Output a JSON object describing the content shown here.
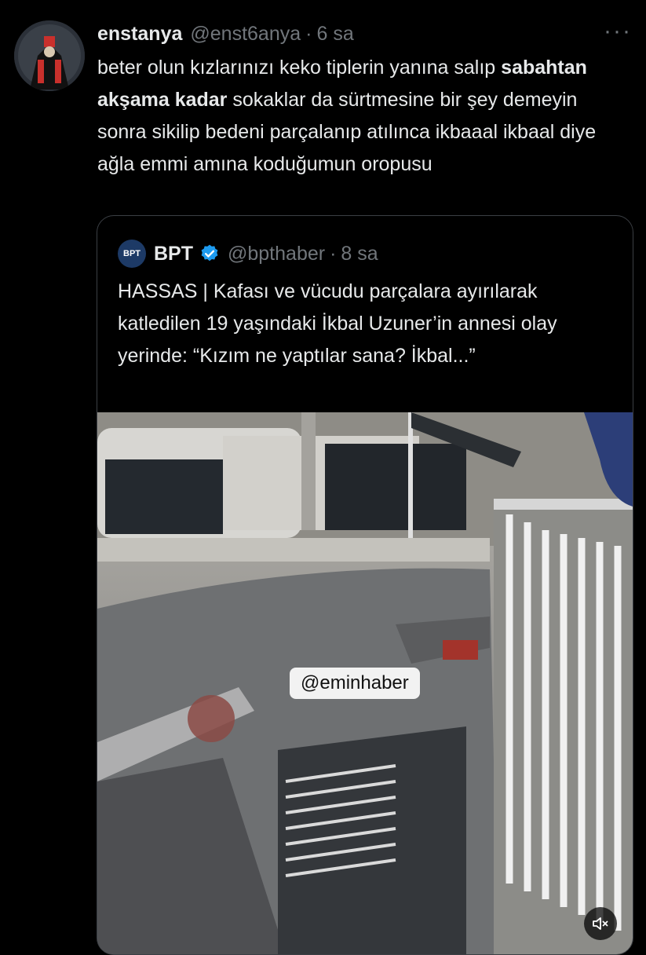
{
  "tweet": {
    "display_name": "enstanya",
    "handle": "@enst6anya",
    "separator": "·",
    "time": "6 sa",
    "more_icon": "ellipsis-icon",
    "text_part1": "beter olun kızlarınızı keko tiplerin yanına salıp ",
    "text_bold": "sabahtan akşama kadar",
    "text_part2": " sokaklar da sürtmesine bir şey demeyin sonra sikilip bedeni parçalanıp atılınca ikbaaal ikbaal diye ağla emmi amına koduğumun oropusu"
  },
  "quote": {
    "avatar_text": "BPT",
    "display_name": "BPT",
    "verified_icon": "verified-badge-icon",
    "handle": "@bpthaber",
    "separator": "·",
    "time": "8 sa",
    "text": "HASSAS | Kafası ve vücudu parçalara ayırılarak katledilen 19 yaşındaki İkbal Uzuner’in annesi olay yerinde: “Kızım ne yaptılar sana? İkbal...”",
    "media": {
      "watermark": "@eminhaber",
      "mute_icon": "speaker-muted-icon"
    }
  },
  "colors": {
    "background": "#000000",
    "text": "#e7e9ea",
    "secondary": "#71767b",
    "border": "#3b3f44",
    "verified": "#1d9bf0"
  }
}
